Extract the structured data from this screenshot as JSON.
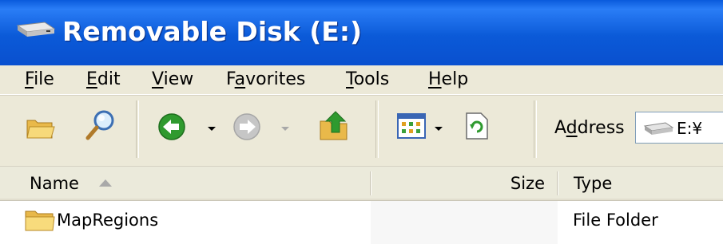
{
  "window": {
    "title": "Removable Disk (E:)",
    "title_icon": "removable-drive-icon"
  },
  "menu": {
    "items": [
      {
        "pre": "",
        "key": "F",
        "post": "ile"
      },
      {
        "pre": "",
        "key": "E",
        "post": "dit"
      },
      {
        "pre": "",
        "key": "V",
        "post": "iew"
      },
      {
        "pre": "F",
        "key": "a",
        "post": "vorites"
      },
      {
        "pre": "",
        "key": "T",
        "post": "ools"
      },
      {
        "pre": "",
        "key": "H",
        "post": "elp"
      }
    ]
  },
  "toolbar": {
    "icons": [
      "folders-icon",
      "search-icon",
      "back-icon",
      "forward-icon",
      "up-icon",
      "views-icon",
      "refresh-icon"
    ],
    "address": {
      "pre": "A",
      "key": "d",
      "post": "dress",
      "value": "E:¥",
      "icon": "removable-drive-icon"
    }
  },
  "columns": {
    "name": "Name",
    "size": "Size",
    "type": "Type",
    "sort": "ascending"
  },
  "rows": [
    {
      "name": "MapRegions",
      "size": "",
      "type": "File Folder",
      "icon": "folder-icon"
    }
  ],
  "colors": {
    "titlebar": "#0a5bdc",
    "chrome": "#ece9d8",
    "back_green": "#2f9a2f"
  }
}
